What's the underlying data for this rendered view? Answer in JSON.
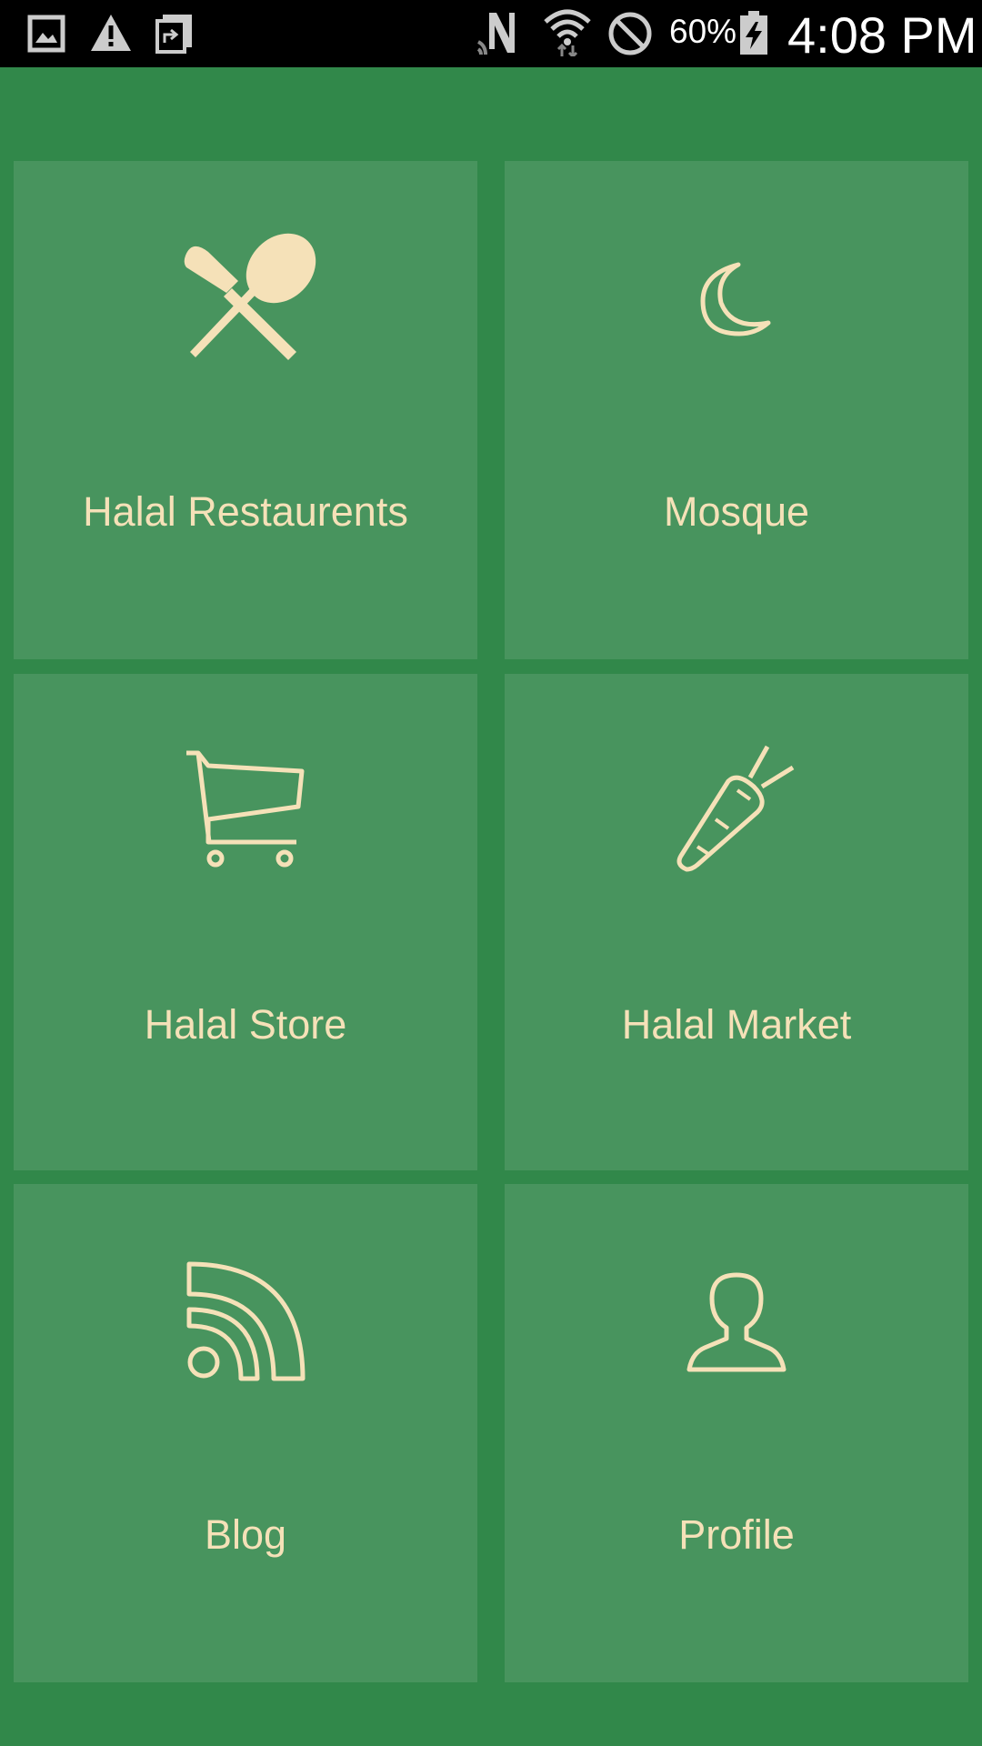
{
  "status_bar": {
    "battery": "60%",
    "time": "4:08 PM",
    "icons": [
      "image-notification-icon",
      "warning-icon",
      "screen-share-icon",
      "nfc-icon",
      "wifi-icon",
      "do-not-disturb-icon",
      "battery-charging-icon"
    ]
  },
  "colors": {
    "background": "#31884a",
    "tile": "#48945e",
    "icon_and_text": "#f5e1b8"
  },
  "tiles": [
    {
      "label": "Halal Restaurents",
      "icon": "fork-spoon-icon"
    },
    {
      "label": "Mosque",
      "icon": "crescent-moon-icon"
    },
    {
      "label": "Halal Store",
      "icon": "shopping-cart-icon"
    },
    {
      "label": "Halal Market",
      "icon": "carrot-icon"
    },
    {
      "label": "Blog",
      "icon": "rss-feed-icon"
    },
    {
      "label": "Profile",
      "icon": "user-profile-icon"
    }
  ]
}
